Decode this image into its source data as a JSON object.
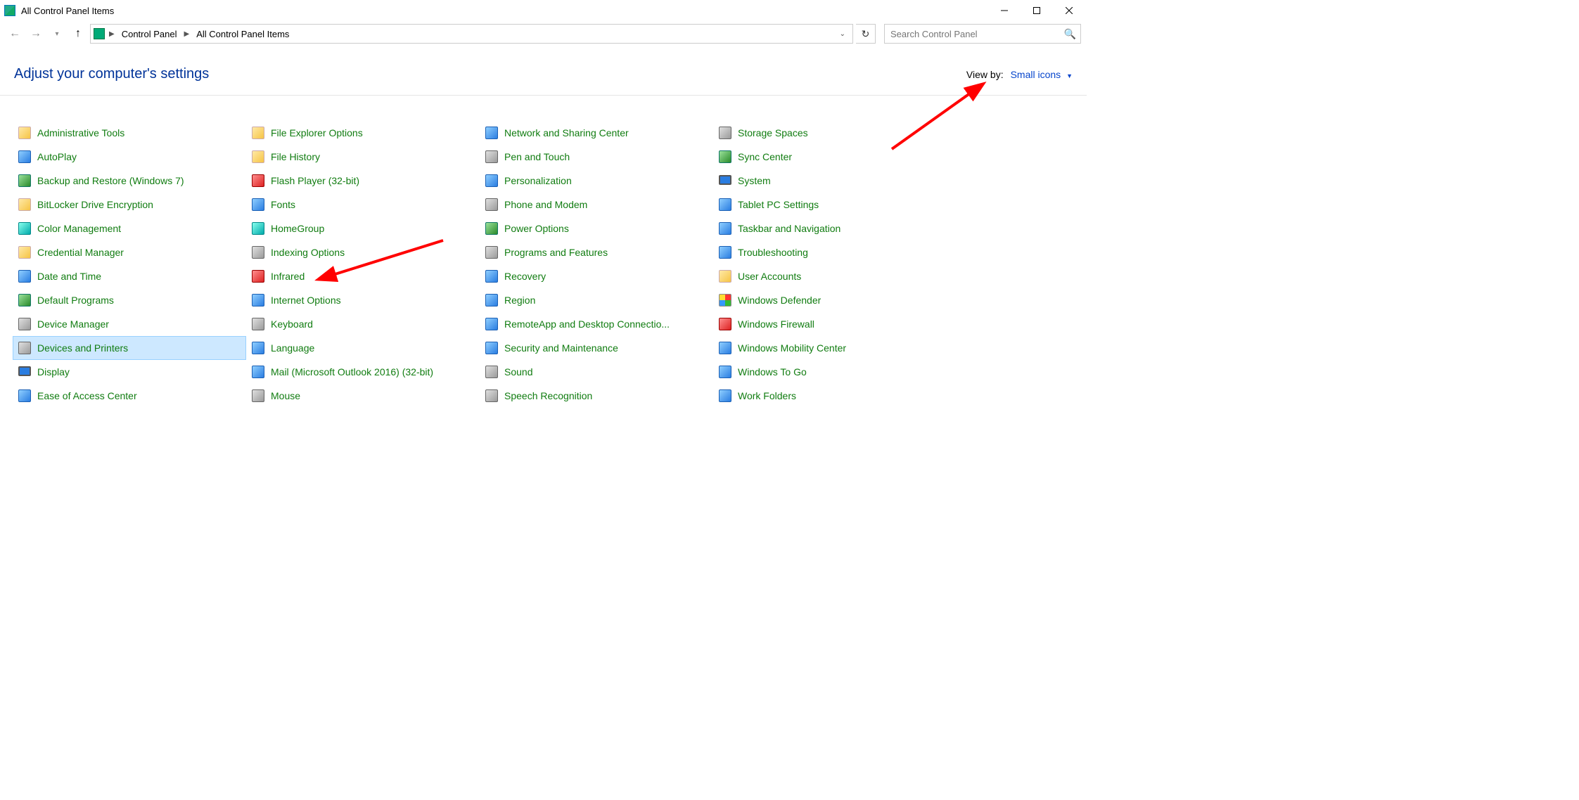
{
  "window": {
    "title": "All Control Panel Items"
  },
  "breadcrumbs": {
    "root": "Control Panel",
    "current": "All Control Panel Items"
  },
  "search": {
    "placeholder": "Search Control Panel"
  },
  "header": {
    "title": "Adjust your computer's settings",
    "view_by_label": "View by:",
    "view_by_value": "Small icons"
  },
  "items": [
    {
      "label": "Administrative Tools",
      "icon": "yel"
    },
    {
      "label": "AutoPlay",
      "icon": "blue"
    },
    {
      "label": "Backup and Restore (Windows 7)",
      "icon": "green"
    },
    {
      "label": "BitLocker Drive Encryption",
      "icon": "yel"
    },
    {
      "label": "Color Management",
      "icon": "teal"
    },
    {
      "label": "Credential Manager",
      "icon": "yel"
    },
    {
      "label": "Date and Time",
      "icon": "blue"
    },
    {
      "label": "Default Programs",
      "icon": "green"
    },
    {
      "label": "Device Manager",
      "icon": "grey"
    },
    {
      "label": "Devices and Printers",
      "icon": "grey",
      "selected": true
    },
    {
      "label": "Display",
      "icon": "mon"
    },
    {
      "label": "Ease of Access Center",
      "icon": "blue"
    },
    {
      "label": "File Explorer Options",
      "icon": "yel"
    },
    {
      "label": "File History",
      "icon": "yel"
    },
    {
      "label": "Flash Player (32-bit)",
      "icon": "red"
    },
    {
      "label": "Fonts",
      "icon": "blue"
    },
    {
      "label": "HomeGroup",
      "icon": "teal"
    },
    {
      "label": "Indexing Options",
      "icon": "grey"
    },
    {
      "label": "Infrared",
      "icon": "red"
    },
    {
      "label": "Internet Options",
      "icon": "blue"
    },
    {
      "label": "Keyboard",
      "icon": "grey"
    },
    {
      "label": "Language",
      "icon": "blue"
    },
    {
      "label": "Mail (Microsoft Outlook 2016) (32-bit)",
      "icon": "blue"
    },
    {
      "label": "Mouse",
      "icon": "grey"
    },
    {
      "label": "Network and Sharing Center",
      "icon": "blue"
    },
    {
      "label": "Pen and Touch",
      "icon": "grey"
    },
    {
      "label": "Personalization",
      "icon": "blue"
    },
    {
      "label": "Phone and Modem",
      "icon": "grey"
    },
    {
      "label": "Power Options",
      "icon": "green"
    },
    {
      "label": "Programs and Features",
      "icon": "grey"
    },
    {
      "label": "Recovery",
      "icon": "blue"
    },
    {
      "label": "Region",
      "icon": "blue"
    },
    {
      "label": "RemoteApp and Desktop Connectio...",
      "icon": "blue"
    },
    {
      "label": "Security and Maintenance",
      "icon": "blue"
    },
    {
      "label": "Sound",
      "icon": "grey"
    },
    {
      "label": "Speech Recognition",
      "icon": "grey"
    },
    {
      "label": "Storage Spaces",
      "icon": "grey"
    },
    {
      "label": "Sync Center",
      "icon": "green"
    },
    {
      "label": "System",
      "icon": "mon"
    },
    {
      "label": "Tablet PC Settings",
      "icon": "blue"
    },
    {
      "label": "Taskbar and Navigation",
      "icon": "blue"
    },
    {
      "label": "Troubleshooting",
      "icon": "blue"
    },
    {
      "label": "User Accounts",
      "icon": "yel"
    },
    {
      "label": "Windows Defender",
      "icon": "shield"
    },
    {
      "label": "Windows Firewall",
      "icon": "red"
    },
    {
      "label": "Windows Mobility Center",
      "icon": "blue"
    },
    {
      "label": "Windows To Go",
      "icon": "blue"
    },
    {
      "label": "Work Folders",
      "icon": "blue"
    }
  ]
}
